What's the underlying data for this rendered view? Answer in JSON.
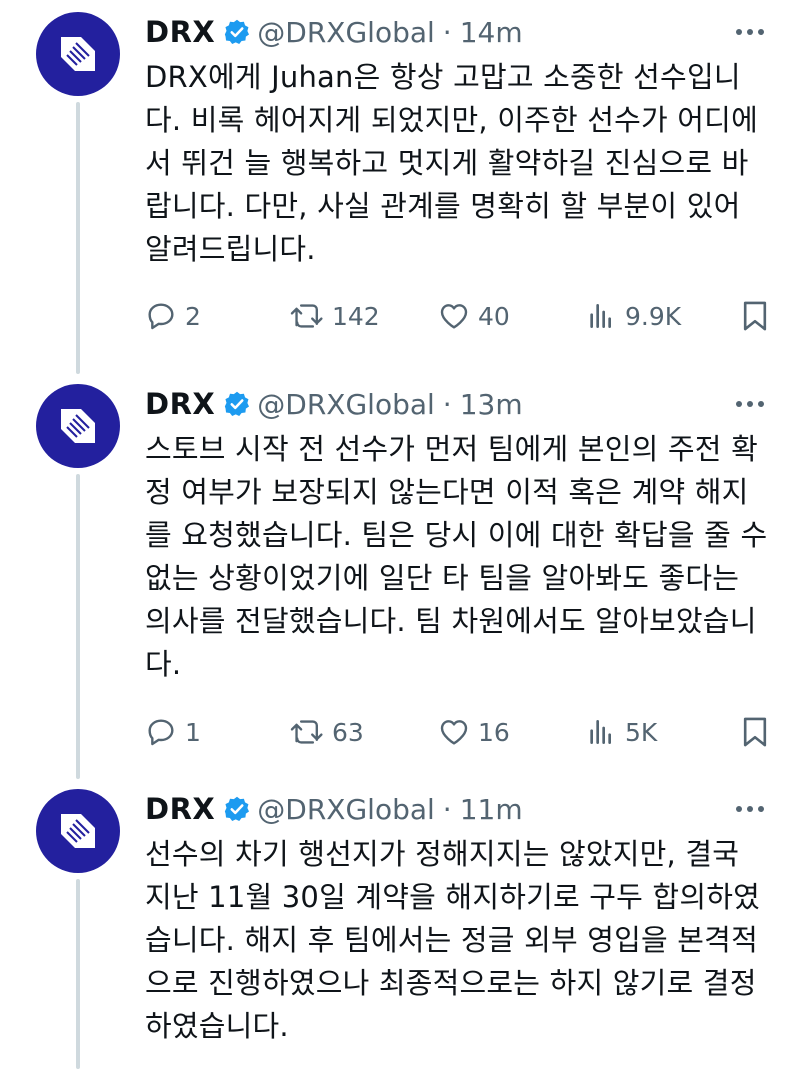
{
  "tweets": [
    {
      "display_name": "DRX",
      "handle": "@DRXGlobal",
      "separator": "·",
      "time": "14m",
      "text": "DRX에게 Juhan은 항상 고맙고 소중한 선수입니\n다. 비록 헤어지게 되었지만, 이주한 선수가 어디에\n서 뛰건 늘 행복하고 멋지게 활약하길 진심으로 바\n랍니다. 다만, 사실 관계를 명확히 할 부분이 있어\n알려드립니다.",
      "replies": "2",
      "reposts": "142",
      "likes": "40",
      "views": "9.9K"
    },
    {
      "display_name": "DRX",
      "handle": "@DRXGlobal",
      "separator": "·",
      "time": "13m",
      "text": "스토브 시작 전 선수가 먼저 팀에게 본인의 주전 확\n정 여부가 보장되지 않는다면 이적 혹은 계약 해지\n를 요청했습니다. 팀은 당시 이에 대한 확답을 줄 수\n없는 상황이었기에 일단 타 팀을 알아봐도 좋다는\n의사를 전달했습니다. 팀 차원에서도 알아보았습니\n다.",
      "replies": "1",
      "reposts": "63",
      "likes": "16",
      "views": "5K"
    },
    {
      "display_name": "DRX",
      "handle": "@DRXGlobal",
      "separator": "·",
      "time": "11m",
      "text": "선수의 차기 행선지가 정해지지는 않았지만, 결국\n지난 11월 30일 계약을 해지하기로 구두 합의하였\n습니다. 해지 후 팀에서는 정글 외부 영입을 본격적\n으로 진행하였으나 최종적으로는 하지 않기로 결정\n하였습니다."
    }
  ],
  "colors": {
    "avatar_bg": "#23209e",
    "verified": "#1d9bf0",
    "muted": "#536471",
    "thread_line": "#cfd9de"
  },
  "icons": [
    "drx-logo-icon",
    "verified-badge-icon",
    "more-icon",
    "reply-icon",
    "repost-icon",
    "like-icon",
    "views-icon",
    "bookmark-icon"
  ]
}
